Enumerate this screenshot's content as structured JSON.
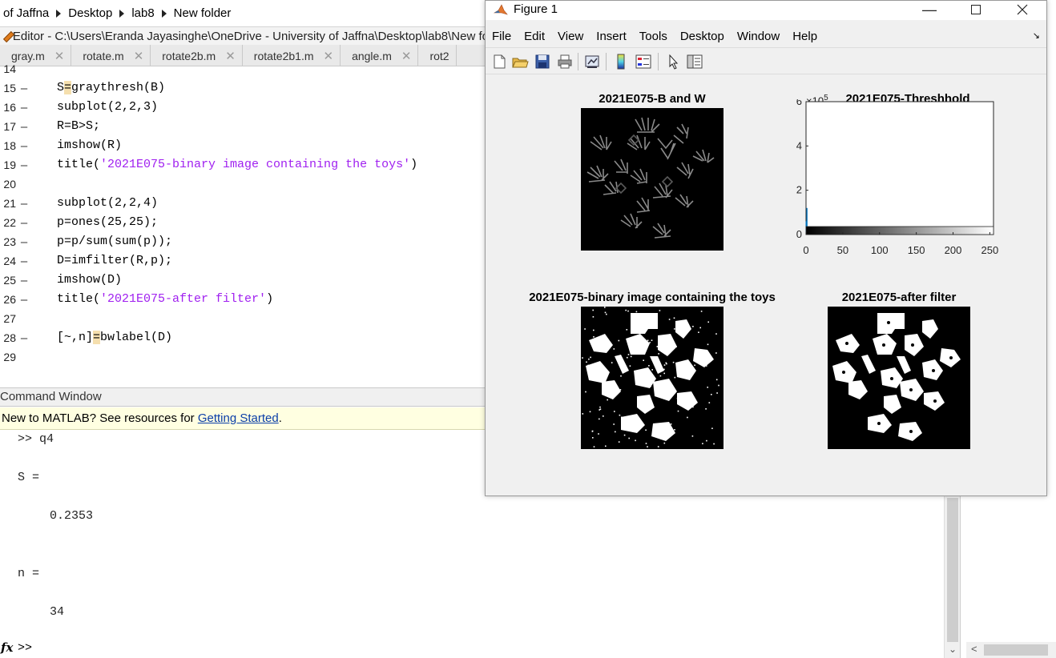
{
  "breadcrumb": [
    "of Jaffna",
    "Desktop",
    "lab8",
    "New folder"
  ],
  "editor": {
    "title": "Editor - C:\\Users\\Eranda Jayasinghe\\OneDrive - University of Jaffna\\Desktop\\lab8\\New fo",
    "tabs": [
      "gray.m",
      "rotate.m",
      "rotate2b.m",
      "rotate2b1.m",
      "angle.m",
      "rot2"
    ],
    "tab_close": "✕",
    "lines": [
      {
        "n": "14",
        "dash": "",
        "pre": "",
        "hl": "",
        "post": "",
        "str": "",
        "tail": ""
      },
      {
        "n": "15",
        "dash": "–",
        "pre": "S",
        "hl": "=",
        "post": "graythresh(B)",
        "str": "",
        "tail": ""
      },
      {
        "n": "16",
        "dash": "–",
        "pre": "subplot(2,2,3)",
        "hl": "",
        "post": "",
        "str": "",
        "tail": ""
      },
      {
        "n": "17",
        "dash": "–",
        "pre": "R=B>S;",
        "hl": "",
        "post": "",
        "str": "",
        "tail": ""
      },
      {
        "n": "18",
        "dash": "–",
        "pre": "imshow(R)",
        "hl": "",
        "post": "",
        "str": "",
        "tail": ""
      },
      {
        "n": "19",
        "dash": "–",
        "pre": "title(",
        "hl": "",
        "post": "",
        "str": "'2021E075-binary image containing the toys'",
        "tail": ")"
      },
      {
        "n": "20",
        "dash": "",
        "pre": "",
        "hl": "",
        "post": "",
        "str": "",
        "tail": ""
      },
      {
        "n": "21",
        "dash": "–",
        "pre": "subplot(2,2,4)",
        "hl": "",
        "post": "",
        "str": "",
        "tail": ""
      },
      {
        "n": "22",
        "dash": "–",
        "pre": "p=ones(25,25);",
        "hl": "",
        "post": "",
        "str": "",
        "tail": ""
      },
      {
        "n": "23",
        "dash": "–",
        "pre": "p=p/sum(sum(p));",
        "hl": "",
        "post": "",
        "str": "",
        "tail": ""
      },
      {
        "n": "24",
        "dash": "–",
        "pre": "D=imfilter(R,p);",
        "hl": "",
        "post": "",
        "str": "",
        "tail": ""
      },
      {
        "n": "25",
        "dash": "–",
        "pre": "imshow(D)",
        "hl": "",
        "post": "",
        "str": "",
        "tail": ""
      },
      {
        "n": "26",
        "dash": "–",
        "pre": "title(",
        "hl": "",
        "post": "",
        "str": "'2021E075-after filter'",
        "tail": ")"
      },
      {
        "n": "27",
        "dash": "",
        "pre": "",
        "hl": "",
        "post": "",
        "str": "",
        "tail": ""
      },
      {
        "n": "28",
        "dash": "–",
        "pre": "[~,n]",
        "hl": "=",
        "post": "bwlabel(D)",
        "str": "",
        "tail": ""
      },
      {
        "n": "29",
        "dash": "",
        "pre": "",
        "hl": "",
        "post": "",
        "str": "",
        "tail": ""
      }
    ]
  },
  "command_window": {
    "header": "Command Window",
    "banner_text": "New to MATLAB? See resources for ",
    "banner_link": "Getting Started",
    "banner_end": ".",
    "output": [
      ">> q4",
      "S =",
      "0.2353",
      "n =",
      "34"
    ],
    "prompt": ">>",
    "fx": "fx"
  },
  "figure": {
    "title": "Figure 1",
    "menus": [
      "File",
      "Edit",
      "View",
      "Insert",
      "Tools",
      "Desktop",
      "Window",
      "Help"
    ],
    "toolbar_icons": [
      "new-figure-icon",
      "open-file-icon",
      "save-icon",
      "print-icon",
      "link-plot-icon",
      "colorbar-icon",
      "legend-icon",
      "pointer-icon",
      "property-editor-icon"
    ],
    "axes_titles": {
      "bw": "2021E075-B and W",
      "threshold": "2021E075-Threshhold",
      "binary": "2021E075-binary image containing the toys",
      "filtered": "2021E075-after filter"
    }
  },
  "chart_data": {
    "type": "bar",
    "title": "2021E075-Threshhold",
    "xlabel": "",
    "ylabel": "",
    "y_exponent_label": "×10",
    "y_exponent": "5",
    "xlim": [
      0,
      255
    ],
    "ylim": [
      0,
      6
    ],
    "xticks": [
      "0",
      "50",
      "100",
      "150",
      "200",
      "250"
    ],
    "yticks": [
      "0",
      "2",
      "4",
      "6"
    ],
    "x": [
      0,
      1,
      2,
      3,
      4,
      5,
      6,
      8,
      10,
      75,
      76,
      77,
      148,
      149,
      150,
      151,
      152
    ],
    "values": [
      0.6,
      1.2,
      0.35,
      0.18,
      0.12,
      0.08,
      0.05,
      0.03,
      0.02,
      0.04,
      0.06,
      0.04,
      0.05,
      0.1,
      0.18,
      0.1,
      0.05
    ],
    "bar_color": "#0072bd",
    "colorbar": "grayscale"
  }
}
